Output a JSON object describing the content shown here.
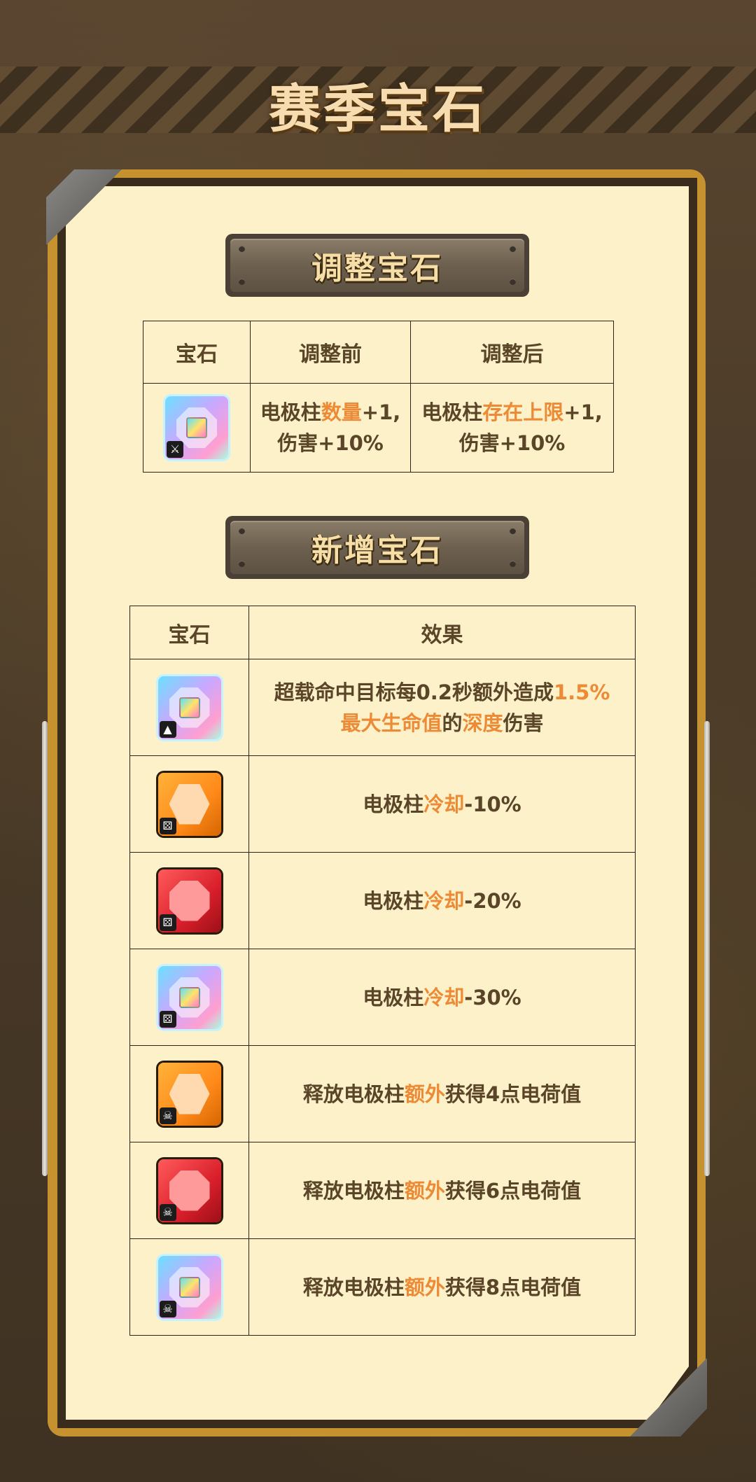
{
  "page": {
    "title": "赛季宝石"
  },
  "adjust": {
    "heading": "调整宝石",
    "headers": [
      "宝石",
      "调整前",
      "调整后"
    ],
    "row": {
      "gem": "prism",
      "before": {
        "pre": "电极柱",
        "hl": "数量",
        "post": "+1,",
        "line2": "伤害+10%"
      },
      "after": {
        "pre": "电极柱",
        "hl": "存在上限",
        "post": "+1,",
        "line2": "伤害+10%"
      }
    }
  },
  "added": {
    "heading": "新增宝石",
    "headers": [
      "宝石",
      "效果"
    ],
    "rows": [
      {
        "gem": "prism",
        "badge": "boot-icon",
        "l1_pre": "超载命中目标每0.2秒额外造成",
        "l1_hl": "1.5%",
        "l2_hl": "最大生命值",
        "l2_mid": "的",
        "l2_hl2": "深度",
        "l2_post": "伤害"
      },
      {
        "gem": "orange",
        "badge": "dice-icon",
        "pre": "电极柱",
        "hl": "冷却",
        "post": "-10%"
      },
      {
        "gem": "red",
        "badge": "dice-icon",
        "pre": "电极柱",
        "hl": "冷却",
        "post": "-20%"
      },
      {
        "gem": "prism",
        "badge": "dice-icon",
        "pre": "电极柱",
        "hl": "冷却",
        "post": "-30%"
      },
      {
        "gem": "orange",
        "badge": "skull-icon",
        "pre": "释放电极柱",
        "hl": "额外",
        "post": "获得4点电荷值"
      },
      {
        "gem": "red",
        "badge": "skull-icon",
        "pre": "释放电极柱",
        "hl": "额外",
        "post": "获得6点电荷值"
      },
      {
        "gem": "prism",
        "badge": "skull-icon",
        "pre": "释放电极柱",
        "hl": "额外",
        "post": "获得8点电荷值"
      }
    ]
  },
  "colors": {
    "highlight": "#ec8a35",
    "text": "#5b4528",
    "paper": "#fdf1c9",
    "frame": "#c5922f"
  }
}
